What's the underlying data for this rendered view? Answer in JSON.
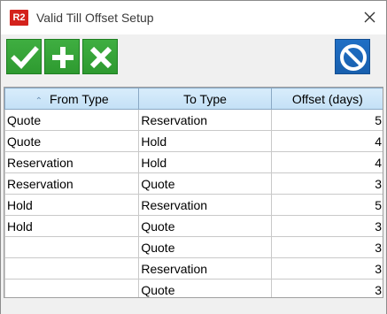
{
  "window": {
    "app_badge": "R2",
    "title": "Valid Till Offset Setup"
  },
  "toolbar": {
    "buttons": [
      {
        "name": "confirm",
        "icon": "checkmark-icon"
      },
      {
        "name": "add",
        "icon": "plus-icon"
      },
      {
        "name": "delete",
        "icon": "x-icon"
      },
      {
        "name": "cancel",
        "icon": "prohibited-icon"
      }
    ]
  },
  "grid": {
    "columns": [
      "From Type",
      "To Type",
      "Offset (days)"
    ],
    "sort_column": "From Type",
    "rows": [
      {
        "from": "Quote",
        "to": "Reservation",
        "offset": "5"
      },
      {
        "from": "Quote",
        "to": "Hold",
        "offset": "4"
      },
      {
        "from": "Reservation",
        "to": "Hold",
        "offset": "4"
      },
      {
        "from": "Reservation",
        "to": "Quote",
        "offset": "3"
      },
      {
        "from": "Hold",
        "to": "Reservation",
        "offset": "5"
      },
      {
        "from": "Hold",
        "to": "Quote",
        "offset": "3"
      },
      {
        "from": "",
        "to": "Quote",
        "offset": "3"
      },
      {
        "from": "",
        "to": "Reservation",
        "offset": "3"
      },
      {
        "from": "",
        "to": "Quote",
        "offset": "3"
      }
    ]
  },
  "colors": {
    "toolbar_green": "#2e9a30",
    "toolbar_blue": "#185fae",
    "header_blue": "#c3e0f6",
    "app_badge_red": "#d4221c"
  }
}
